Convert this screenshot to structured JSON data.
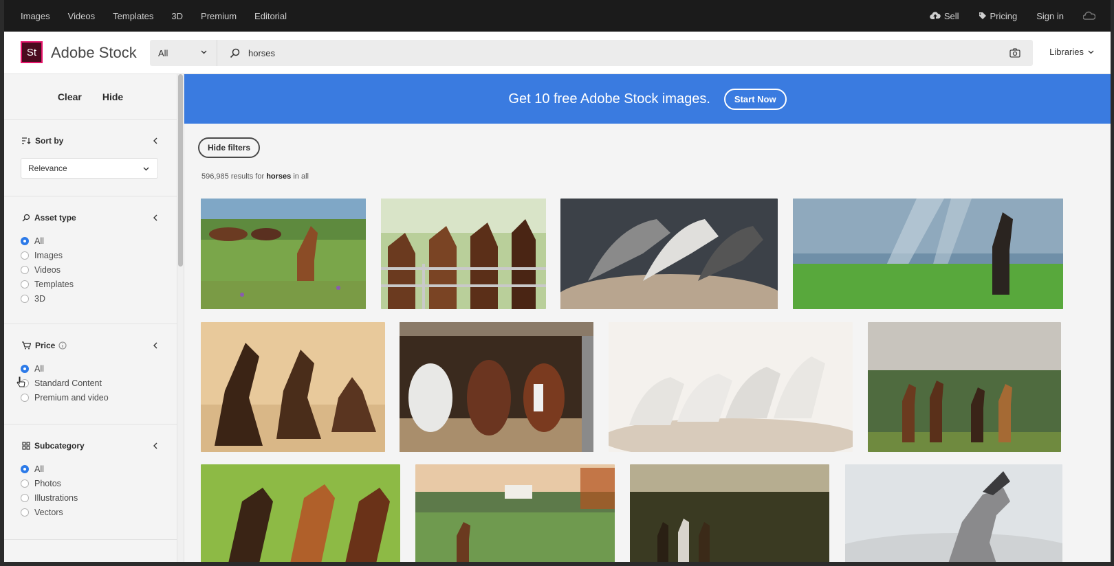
{
  "topnav": {
    "items": [
      "Images",
      "Videos",
      "Templates",
      "3D",
      "Premium",
      "Editorial"
    ],
    "sell": "Sell",
    "pricing": "Pricing",
    "signin": "Sign in"
  },
  "header": {
    "logo_text": "St",
    "brand": "Adobe Stock",
    "scope": "All",
    "search_value": "horses",
    "libraries": "Libraries"
  },
  "sidebar": {
    "clear": "Clear",
    "hide": "Hide",
    "sort": {
      "label": "Sort by",
      "value": "Relevance"
    },
    "asset_type": {
      "label": "Asset type",
      "options": [
        "All",
        "Images",
        "Videos",
        "Templates",
        "3D"
      ],
      "selected": 0
    },
    "price": {
      "label": "Price",
      "options": [
        "All",
        "Standard Content",
        "Premium and video"
      ],
      "selected": 0
    },
    "subcategory": {
      "label": "Subcategory",
      "options": [
        "All",
        "Photos",
        "Illustrations",
        "Vectors"
      ],
      "selected": 0
    }
  },
  "banner": {
    "text": "Get 10 free Adobe Stock images.",
    "button": "Start Now"
  },
  "main": {
    "hide_filters": "Hide filters",
    "results_count": "596,985",
    "results_mid": "results for",
    "results_term": "horses",
    "results_tail": "in all"
  },
  "colors": {
    "accent_blue": "#3a7be0",
    "logo_bg": "#4a0b1e",
    "logo_border": "#e6146b",
    "topbar": "#1b1b1b"
  }
}
